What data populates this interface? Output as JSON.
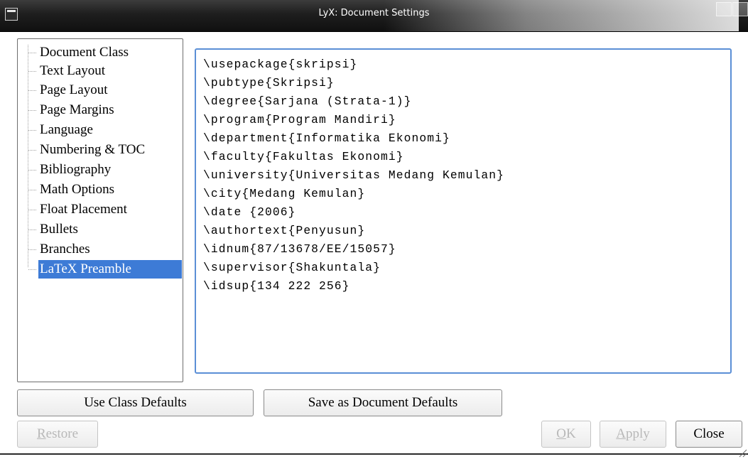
{
  "window": {
    "title": "LyX: Document Settings"
  },
  "sidebar": {
    "items": [
      {
        "label": "Document Class"
      },
      {
        "label": "Text Layout"
      },
      {
        "label": "Page Layout"
      },
      {
        "label": "Page Margins"
      },
      {
        "label": "Language"
      },
      {
        "label": "Numbering & TOC"
      },
      {
        "label": "Bibliography"
      },
      {
        "label": "Math Options"
      },
      {
        "label": "Float Placement"
      },
      {
        "label": "Bullets"
      },
      {
        "label": "Branches"
      },
      {
        "label": "LaTeX Preamble",
        "selected": true
      }
    ]
  },
  "preamble": {
    "lines": [
      "\\usepackage{skripsi}",
      "\\pubtype{Skripsi}",
      "\\degree{Sarjana (Strata-1)}",
      "\\program{Program Mandiri}",
      "\\department{Informatika Ekonomi}",
      "\\faculty{Fakultas Ekonomi}",
      "\\university{Universitas Medang Kemulan}",
      "\\city{Medang Kemulan}",
      "\\date {2006}",
      "\\authortext{Penyusun}",
      "\\idnum{87/13678/EE/15057}",
      "\\supervisor{Shakuntala}",
      "\\idsup{134 222 256}"
    ]
  },
  "buttons": {
    "use_class_defaults": "Use Class Defaults",
    "save_as_document_defaults": "Save as Document Defaults",
    "restore_mnemonic": "R",
    "restore_rest": "estore",
    "ok_mnemonic": "O",
    "ok_rest": "K",
    "apply_mnemonic": "A",
    "apply_rest": "pply",
    "close": "Close"
  },
  "colors": {
    "selection": "#3d7bd6",
    "editor_border": "#5b8fd6",
    "titlebar": "#1e1e1e"
  },
  "icons": {
    "window_menu": "window-menu-icon",
    "resize_grip": "resize-grip-icon"
  }
}
